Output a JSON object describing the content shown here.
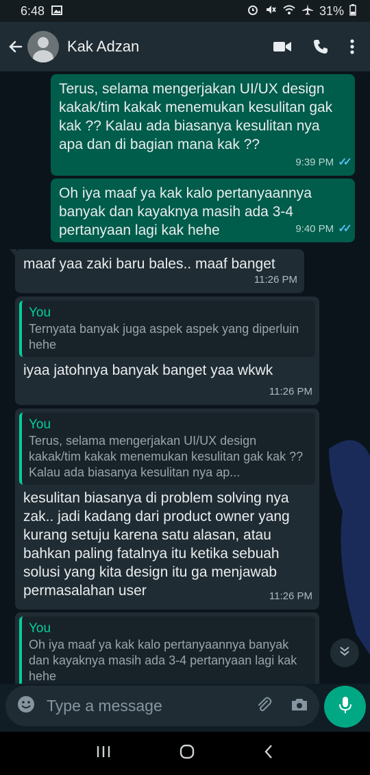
{
  "status_bar": {
    "time": "6:48",
    "battery": "31%"
  },
  "header": {
    "contact_name": "Kak Adzan"
  },
  "messages": [
    {
      "text": "Terus, selama mengerjakan UI/UX design kakak/tim kakak menemukan kesulitan gak kak ?? Kalau ada biasanya kesulitan nya apa dan di bagian mana kak ??",
      "time": "9:39 PM"
    },
    {
      "text": "Oh iya maaf ya kak kalo pertanyaannya banyak dan kayaknya masih ada 3-4 pertanyaan lagi kak hehe",
      "time": "9:40 PM"
    },
    {
      "text": "maaf yaa zaki baru bales.. maaf banget",
      "time": "11:26 PM"
    },
    {
      "quote_name": "You",
      "quote_text": "Ternyata banyak juga aspek aspek yang diperluin hehe",
      "text": "iyaa jatohnya banyak banget yaa wkwk",
      "time": "11:26 PM"
    },
    {
      "quote_name": "You",
      "quote_text": "Terus, selama mengerjakan UI/UX design kakak/tim kakak menemukan kesulitan gak kak ?? Kalau ada biasanya kesulitan nya ap...",
      "text": "kesulitan biasanya di problem solving nya zak.. jadi kadang dari product owner yang kurang setuju karena satu alasan, atau bahkan paling fatalnya itu ketika sebuah solusi yang kita design itu ga menjawab permasalahan user",
      "time": "11:26 PM"
    },
    {
      "quote_name": "You",
      "quote_text": "Oh iya maaf ya kak kalo pertanyaannya banyak dan kayaknya masih ada 3-4 pertanyaan lagi kak hehe"
    }
  ],
  "composer": {
    "placeholder": "Type a message"
  },
  "colors": {
    "outgoing": "#005c4b",
    "incoming": "#202c33",
    "accent": "#00a884",
    "read_ticks": "#53bdeb"
  },
  "icons": [
    "back-arrow-icon",
    "video-call-icon",
    "phone-icon",
    "more-vert-icon",
    "emoji-icon",
    "attach-icon",
    "camera-icon",
    "mic-icon",
    "chevron-down-double-icon"
  ]
}
